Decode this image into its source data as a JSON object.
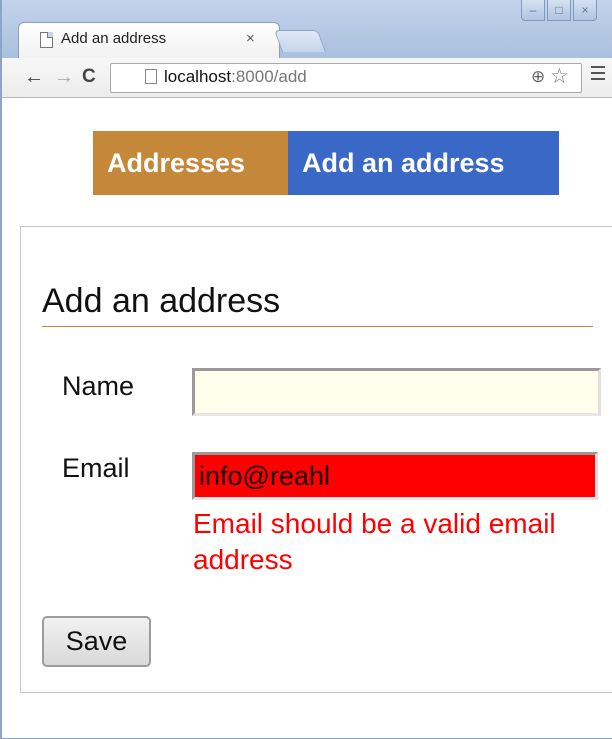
{
  "browser": {
    "tab_title": "Add an address",
    "tab_close": "×",
    "url_host": "localhost",
    "url_rest": ":8000/add",
    "back_glyph": "←",
    "forward_glyph": "→",
    "reload_glyph": "C",
    "zoom_glyph": "⊕",
    "star_glyph": "☆",
    "minimize_glyph": "–",
    "maximize_glyph": "□",
    "close_glyph": "×"
  },
  "nav": {
    "addresses_label": "Addresses",
    "add_label": "Add an address",
    "addresses_color": "#c5883b",
    "add_color": "#3968c6"
  },
  "form": {
    "title": "Add an address",
    "name_label": "Name",
    "name_value": "",
    "email_label": "Email",
    "email_value": "info@reahl",
    "email_error": "Email should be a valid email address",
    "save_label": "Save",
    "error_color": "#ff0000"
  }
}
